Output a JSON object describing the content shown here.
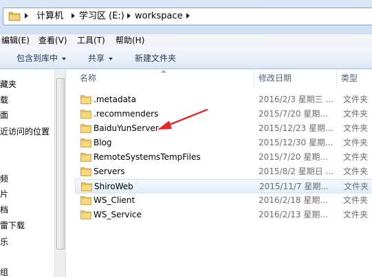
{
  "address_bar": {
    "breadcrumbs": [
      "计算机",
      "学习区 (E:)",
      "workspace"
    ]
  },
  "menu": {
    "items": [
      "编辑(E)",
      "查看(V)",
      "工具(T)",
      "帮助(H)"
    ]
  },
  "toolbar": {
    "include_library": "包含到库中",
    "share": "共享",
    "new_folder": "新建文件夹"
  },
  "nav": {
    "items": [
      "藏夹",
      "载",
      "面",
      "近访问的位置",
      "",
      "",
      "频",
      "片",
      "档",
      "雷下载",
      "乐",
      "",
      "组"
    ]
  },
  "columns": {
    "name": "名称",
    "date": "修改日期",
    "type": "类型"
  },
  "files": [
    {
      "name": ".metadata",
      "date": "2016/2/3 星期三 ...",
      "type": "文件夹"
    },
    {
      "name": ".recommenders",
      "date": "2015/7/20 星期...",
      "type": "文件夹"
    },
    {
      "name": "BaiduYunServer",
      "date": "2015/12/23 星期...",
      "type": "文件夹"
    },
    {
      "name": "Blog",
      "date": "2015/12/30 星期...",
      "type": "文件夹"
    },
    {
      "name": "RemoteSystemsTempFiles",
      "date": "2015/7/20 星期...",
      "type": "文件夹"
    },
    {
      "name": "Servers",
      "date": "2015/8/2 星期日 ...",
      "type": "文件夹"
    },
    {
      "name": "ShiroWeb",
      "date": "2015/11/7 星期...",
      "type": "文件夹"
    },
    {
      "name": "WS_Client",
      "date": "2016/2/18 星期...",
      "type": "文件夹"
    },
    {
      "name": "WS_Service",
      "date": "2016/2/13 星期...",
      "type": "文件夹"
    }
  ],
  "selected_file": "ShiroWeb",
  "colors": {
    "annotation_arrow": "#e8262a",
    "folder": "#e8c060",
    "selection": "#e3eff9"
  }
}
